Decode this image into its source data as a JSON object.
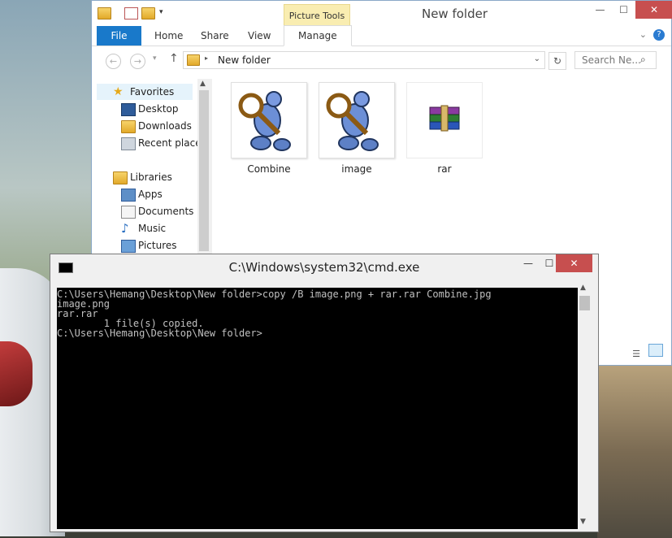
{
  "explorer": {
    "title": "New folder",
    "context_tab": "Picture Tools",
    "tabs": [
      "File",
      "Home",
      "Share",
      "View",
      "Manage"
    ],
    "address": "New folder",
    "search_placeholder": "Search Ne...",
    "help": "?",
    "nav": {
      "favorites": "Favorites",
      "items": [
        "Desktop",
        "Downloads",
        "Recent places"
      ],
      "libraries": "Libraries",
      "lib_items": [
        "Apps",
        "Documents",
        "Music",
        "Pictures"
      ]
    },
    "files": [
      {
        "name": "Combine",
        "icon": "magnifier-person-icon"
      },
      {
        "name": "image",
        "icon": "magnifier-person-icon"
      },
      {
        "name": "rar",
        "icon": "winrar-archive-icon"
      }
    ]
  },
  "cmd": {
    "title": "C:\\Windows\\system32\\cmd.exe",
    "lines": [
      "C:\\Users\\Hemang\\Desktop\\New folder>copy /B image.png + rar.rar Combine.jpg",
      "image.png",
      "rar.rar",
      "        1 file(s) copied.",
      "",
      "C:\\Users\\Hemang\\Desktop\\New folder>"
    ]
  }
}
